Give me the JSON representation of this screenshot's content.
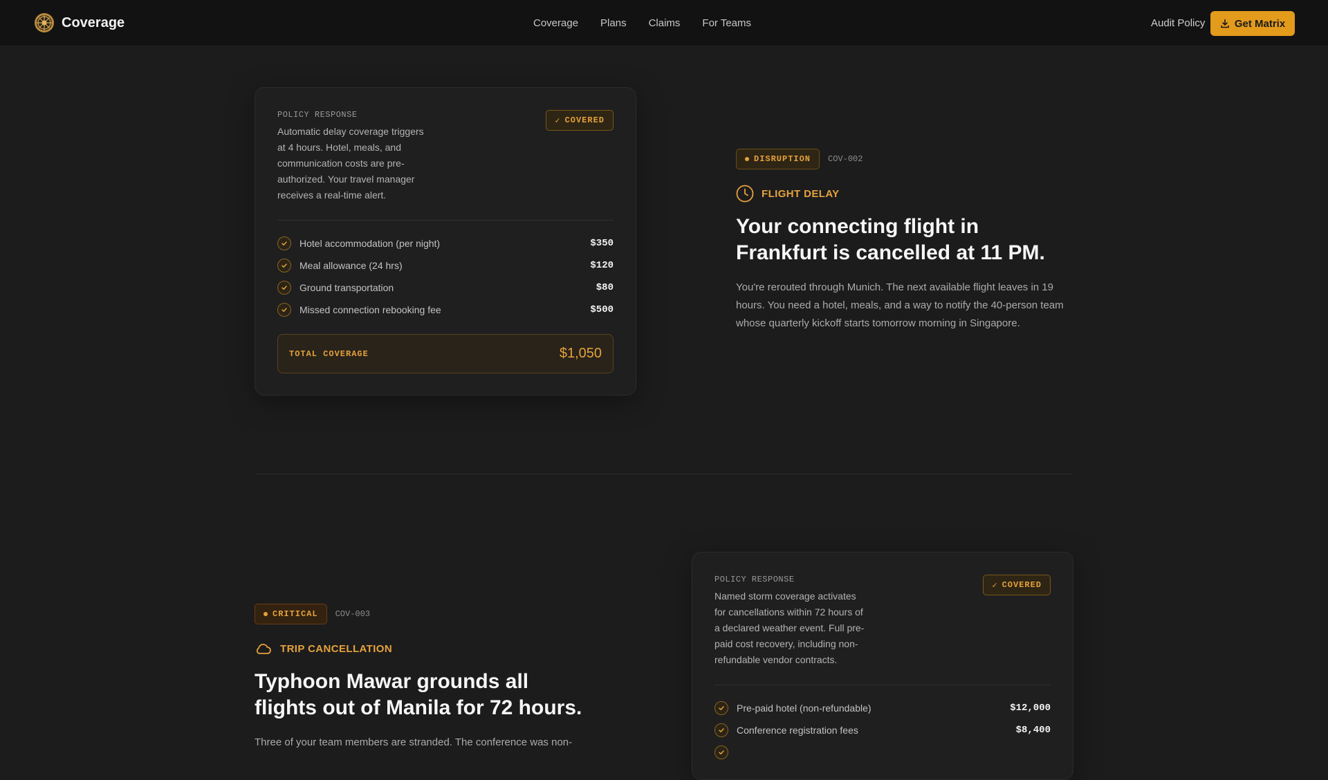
{
  "nav": {
    "brand": "Coverage",
    "links": [
      "Coverage",
      "Plans",
      "Claims",
      "For Teams"
    ],
    "audit": "Audit Policy",
    "cta": "Get Matrix"
  },
  "colors": {
    "accent": "#e39b1c",
    "background": "#1c1c1d",
    "card": "#1f1f20"
  },
  "section1": {
    "card": {
      "label": "POLICY RESPONSE",
      "description": "Automatic delay coverage triggers at 4 hours. Hotel, meals, and communication costs are pre-authorized. Your travel manager receives a real-time alert.",
      "badge": "COVERED",
      "items": [
        {
          "label": "Hotel accommodation (per night)",
          "amount": "$350"
        },
        {
          "label": "Meal allowance (24 hrs)",
          "amount": "$120"
        },
        {
          "label": "Ground transportation",
          "amount": "$80"
        },
        {
          "label": "Missed connection rebooking fee",
          "amount": "$500"
        }
      ],
      "total_label": "TOTAL COVERAGE",
      "total_amount": "$1,050"
    },
    "scenario": {
      "tag": "DISRUPTION",
      "code": "COV-002",
      "category": "FLIGHT DELAY",
      "category_icon": "clock-icon",
      "title": "Your connecting flight in Frankfurt is cancelled at 11 PM.",
      "body": "You're rerouted through Munich. The next available flight leaves in 19 hours. You need a hotel, meals, and a way to notify the 40-person team whose quarterly kickoff starts tomorrow morning in Singapore."
    }
  },
  "section2": {
    "scenario": {
      "tag": "CRITICAL",
      "code": "COV-003",
      "category": "TRIP CANCELLATION",
      "category_icon": "cloud-icon",
      "title": "Typhoon Mawar grounds all flights out of Manila for 72 hours.",
      "body": "Three of your team members are stranded. The conference was non-"
    },
    "card": {
      "label": "POLICY RESPONSE",
      "description": "Named storm coverage activates for cancellations within 72 hours of a declared weather event. Full pre-paid cost recovery, including non-refundable vendor contracts.",
      "badge": "COVERED",
      "items": [
        {
          "label": "Pre-paid hotel (non-refundable)",
          "amount": "$12,000"
        },
        {
          "label": "Conference registration fees",
          "amount": "$8,400"
        }
      ]
    }
  }
}
